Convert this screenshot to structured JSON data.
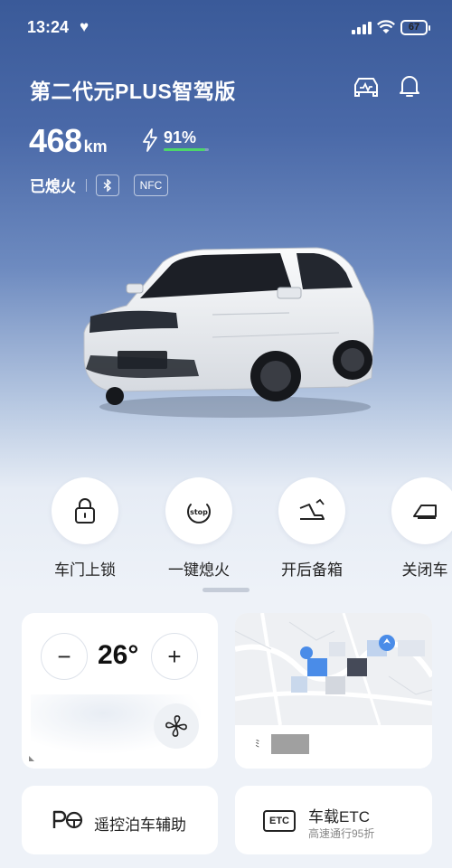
{
  "status_bar": {
    "time": "13:24",
    "battery": "67"
  },
  "header": {
    "car_name": "第二代元PLUS智驾版"
  },
  "vehicle": {
    "range_value": "468",
    "range_unit": "km",
    "charge_percent": "91%",
    "charge_fraction": 0.91,
    "engine_status": "已熄火",
    "nfc_label": "NFC"
  },
  "quick_actions": [
    {
      "label": "车门上锁",
      "icon": "lock-icon"
    },
    {
      "label": "一键熄火",
      "icon": "stop-icon"
    },
    {
      "label": "开后备箱",
      "icon": "trunk-open-icon"
    },
    {
      "label": "关闭车",
      "icon": "close-window-icon"
    }
  ],
  "climate": {
    "temperature": "26°",
    "decrease_symbol": "−",
    "increase_symbol": "+"
  },
  "map_card": {
    "foot_mark": "ﾐ"
  },
  "park_assist": {
    "label": "遥控泊车辅助"
  },
  "etc": {
    "icon_text": "ETC",
    "title": "车载ETC",
    "subtitle": "高速通行95折"
  },
  "colors": {
    "accent_green": "#4cd66a",
    "hero_top": "#3a5a99",
    "map_blue": "#4a8ce8"
  }
}
